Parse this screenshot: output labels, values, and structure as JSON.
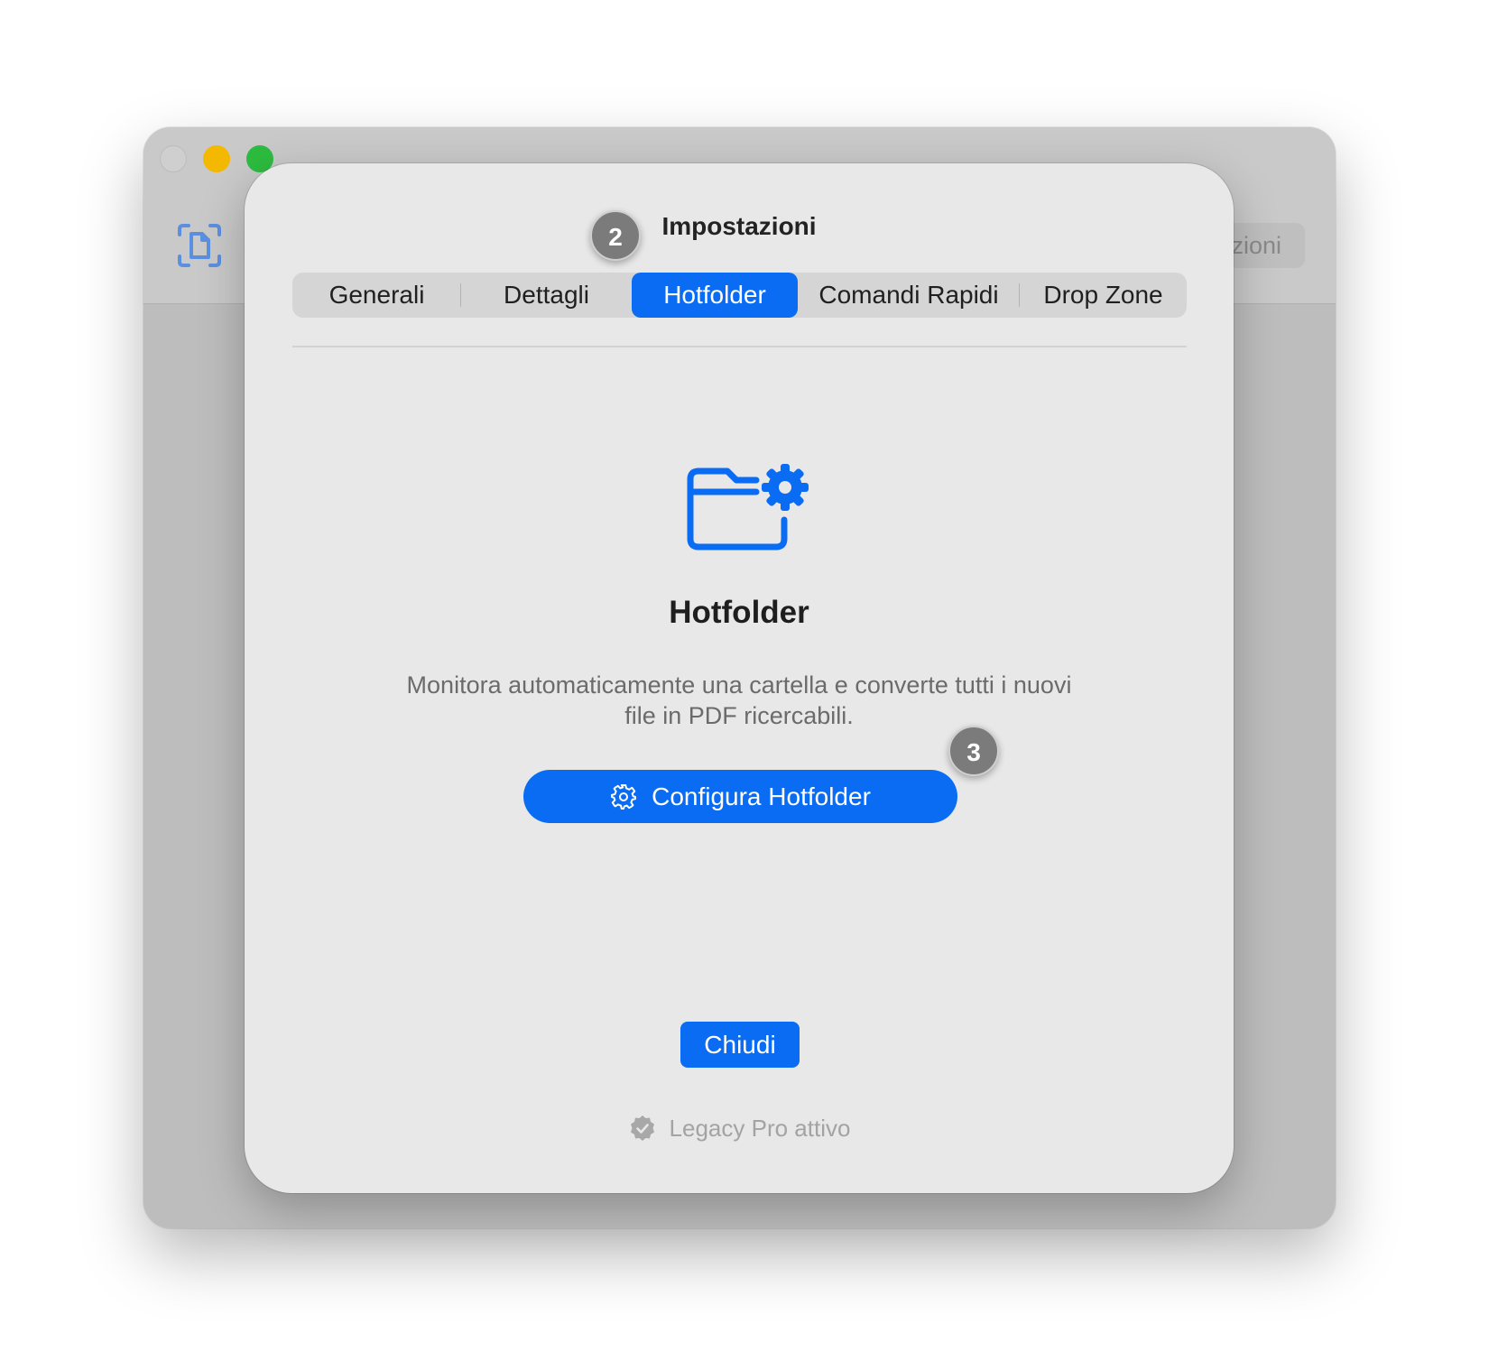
{
  "app": {
    "toolbar_button_label": "zioni",
    "app_icon": "document-scan-icon"
  },
  "sheet": {
    "title": "Impostazioni",
    "badges": {
      "title_badge": "2",
      "button_badge": "3"
    },
    "tabs": [
      {
        "label": "Generali"
      },
      {
        "label": "Dettagli"
      },
      {
        "label": "Hotfolder",
        "selected": true
      },
      {
        "label": "Comandi Rapidi"
      },
      {
        "label": "Drop Zone"
      }
    ],
    "feature": {
      "icon": "folder-gear-icon",
      "title": "Hotfolder",
      "description": "Monitora automaticamente una cartella e converte tutti i nuovi file in PDF ricercabili.",
      "configure_button_label": "Configura Hotfolder"
    },
    "close_button_label": "Chiudi",
    "license_status": "Legacy Pro attivo"
  },
  "colors": {
    "accent": "#0a6cf2",
    "traffic_min": "#f5b800",
    "traffic_max": "#2dbc3f",
    "badge": "#7b7b7b"
  }
}
